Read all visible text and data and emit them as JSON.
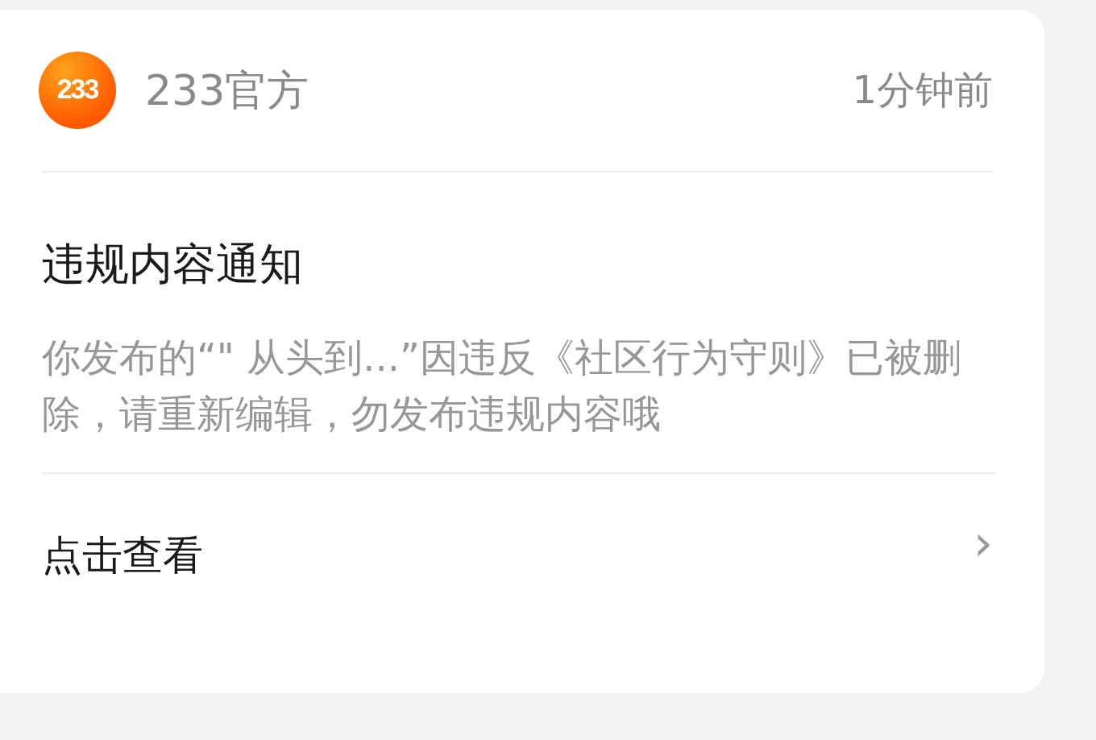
{
  "notice": {
    "logo_text": "233",
    "sender": "233官方",
    "time": "1分钟前",
    "title": "违规内容通知",
    "body": "你发布的“\" 从头到...”因违反《社区行为守则》已被删除，请重新编辑，勿发布违规内容哦",
    "action": "点击查看",
    "chevron": "›"
  }
}
